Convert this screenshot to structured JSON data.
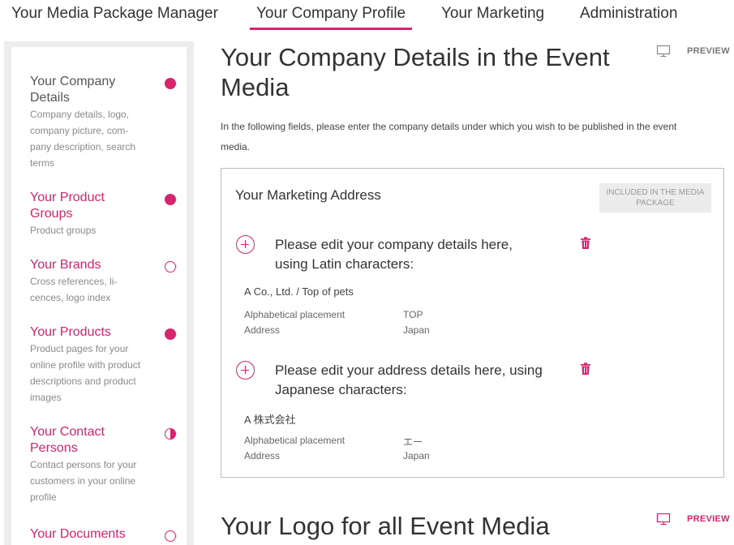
{
  "nav": {
    "tabs": [
      {
        "label": "Your Media Package Manager"
      },
      {
        "label": "Your Company Profile",
        "active": true
      },
      {
        "label": "Your Marketing"
      },
      {
        "label": "Administration"
      }
    ]
  },
  "sidebar": {
    "items": [
      {
        "title": "Your Company Details",
        "desc": "Company details, logo, company picture, com-pany description, search terms",
        "status": "full"
      },
      {
        "title": "Your Product Groups",
        "desc": "Product groups",
        "status": "full"
      },
      {
        "title": "Your Brands",
        "desc": "Cross references, li-cences, logo index",
        "status": "empty"
      },
      {
        "title": "Your Products",
        "desc": "Product pages for your online profile with product descriptions and product images",
        "status": "full"
      },
      {
        "title": "Your Contact Persons",
        "desc": "Contact persons for your customers in your online profile",
        "status": "half"
      },
      {
        "title": "Your Documents",
        "desc": "",
        "status": "empty"
      }
    ]
  },
  "main": {
    "title": "Your Company Details in the Event Media",
    "preview_label": "PREVIEW",
    "intro": "In the following fields, please enter the company details under which you wish to be published in the event media.",
    "box": {
      "title": "Your Marketing Address",
      "badge": "INCLUDED IN THE MEDIA PACKAGE",
      "entries": [
        {
          "heading": "Please edit your company details here, using Latin characters:",
          "name": "A Co., Ltd. / Top of pets",
          "rows": [
            {
              "label": "Alphabetical placement",
              "value": "TOP"
            },
            {
              "label": "Address",
              "value": "Japan"
            }
          ]
        },
        {
          "heading": "Please edit your address details here, using Japanese characters:",
          "name": "A 株式会社",
          "rows": [
            {
              "label": "Alphabetical placement",
              "value": "エー"
            },
            {
              "label": "Address",
              "value": "Japan"
            }
          ]
        }
      ]
    },
    "section2_title": "Your Logo for all Event Media",
    "section2_preview": "PREVIEW"
  },
  "colors": {
    "accent": "#d6246e",
    "sidebar_bg": "#ededed"
  }
}
